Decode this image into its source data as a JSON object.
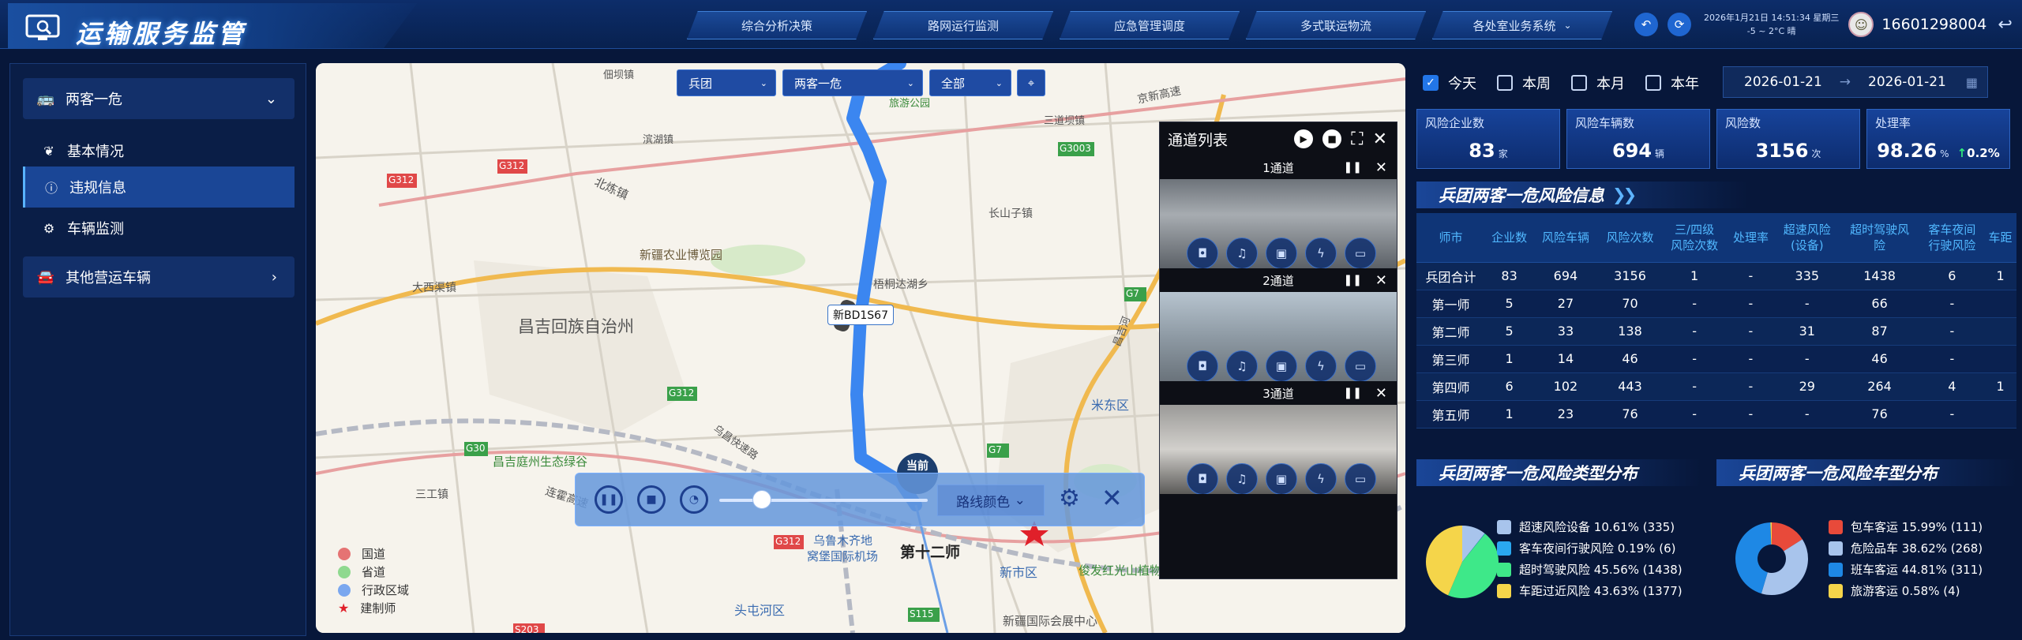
{
  "app": {
    "title": "运输服务监管"
  },
  "nav": [
    {
      "label": "综合分析决策"
    },
    {
      "label": "路网运行监测"
    },
    {
      "label": "应急管理调度"
    },
    {
      "label": "多式联运物流"
    },
    {
      "label": "各处室业务系统"
    }
  ],
  "header": {
    "datetime": "2026年1月21日 14:51:34 星期三",
    "weather": "-5 ~ 2°C 晴",
    "username": "16601298004"
  },
  "sidebar": {
    "group1": "两客一危",
    "items": [
      {
        "label": "基本情况"
      },
      {
        "label": "违规信息"
      },
      {
        "label": "车辆监测"
      }
    ],
    "group2": "其他营运车辆"
  },
  "map": {
    "filters": {
      "unit": "兵团",
      "type": "两客一危",
      "scope": "全部"
    },
    "vehicle_plate": "新BD1S67",
    "current_marker": "当前",
    "labels": {
      "region": "昌吉回族自治州",
      "division": "第十二师",
      "expo": "新疆农业博览园",
      "wetland": "昌吉庭州生态绿谷",
      "airport_line1": "乌鲁木齐地",
      "airport_line2": "窝堡国际机场",
      "place1": "北炼镇",
      "place2": "大西渠镇",
      "place3": "三工镇",
      "place4": "长山子镇",
      "place5": "梧桐达湖乡",
      "place6": "米东区",
      "place7": "新市区",
      "place8": "头屯河区",
      "place9": "新疆国际会展中心",
      "place10": "俊发红光山植物园",
      "place11": "佃坝镇",
      "place12": "滨湖镇",
      "place13": "三道坝镇",
      "place14": "旅游公园",
      "road1": "G312",
      "road2": "G312",
      "road3": "G312",
      "road4": "G312",
      "road5": "G30",
      "road6": "G3003",
      "road7": "G7",
      "road8": "G7",
      "road9": "S115",
      "road10": "S203",
      "road11": "京新高速",
      "road12": "连霍高速",
      "road13": "乌昌快速路",
      "road14": "昌吉河"
    },
    "playback": {
      "route_color_label": "路线颜色"
    },
    "legend": [
      {
        "label": "国道",
        "color": "#e57373"
      },
      {
        "label": "省道",
        "color": "#8fd98f"
      },
      {
        "label": "行政区域",
        "color": "#7aa7ef"
      },
      {
        "label": "建制师",
        "color": "#e0202a"
      }
    ]
  },
  "channels": {
    "title": "通道列表",
    "items": [
      {
        "label": "1通道"
      },
      {
        "label": "2通道"
      },
      {
        "label": "3通道"
      }
    ]
  },
  "period": {
    "options": [
      {
        "label": "今天",
        "checked": true
      },
      {
        "label": "本周",
        "checked": false
      },
      {
        "label": "本月",
        "checked": false
      },
      {
        "label": "本年",
        "checked": false
      }
    ],
    "start": "2026-01-21",
    "end": "2026-01-21"
  },
  "kpis": [
    {
      "label": "风险企业数",
      "value": "83",
      "unit": "家"
    },
    {
      "label": "风险车辆数",
      "value": "694",
      "unit": "辆"
    },
    {
      "label": "风险数",
      "value": "3156",
      "unit": "次"
    },
    {
      "label": "处理率",
      "value": "98.26",
      "unit": "%",
      "trend": "0.2%"
    }
  ],
  "risk_table": {
    "title": "兵团两客一危风险信息",
    "headers": [
      "师市",
      "企业数",
      "风险车辆",
      "风险次数",
      "三/四级\n风险次数",
      "处理率",
      "超速风险\n(设备)",
      "超时驾驶风\n险",
      "客车夜间\n行驶风险",
      "车距"
    ],
    "rows": [
      [
        "兵团合计",
        "83",
        "694",
        "3156",
        "1",
        "-",
        "335",
        "1438",
        "6",
        "1"
      ],
      [
        "第一师",
        "5",
        "27",
        "70",
        "-",
        "-",
        "-",
        "66",
        "-",
        ""
      ],
      [
        "第二师",
        "5",
        "33",
        "138",
        "-",
        "-",
        "31",
        "87",
        "-",
        ""
      ],
      [
        "第三师",
        "1",
        "14",
        "46",
        "-",
        "-",
        "-",
        "46",
        "-",
        ""
      ],
      [
        "第四师",
        "6",
        "102",
        "443",
        "-",
        "-",
        "29",
        "264",
        "4",
        "1"
      ],
      [
        "第五师",
        "1",
        "23",
        "76",
        "-",
        "-",
        "-",
        "76",
        "-",
        ""
      ]
    ]
  },
  "risk_type": {
    "title": "兵团两客一危风险类型分布",
    "items": [
      {
        "label": "超速风险设备",
        "pct": "10.61%",
        "count": "(335)",
        "value": 335,
        "color": "#a8c4ec"
      },
      {
        "label": "客车夜间行驶风险",
        "pct": "0.19%",
        "count": "(6)",
        "value": 6,
        "color": "#2aa8f0"
      },
      {
        "label": "超时驾驶风险",
        "pct": "45.56%",
        "count": "(1438)",
        "value": 1438,
        "color": "#3ee889"
      },
      {
        "label": "车距过近风险",
        "pct": "43.63%",
        "count": "(1377)",
        "value": 1377,
        "color": "#f5d54a"
      }
    ]
  },
  "vehicle_type": {
    "title": "兵团两客一危风险车型分布",
    "items": [
      {
        "label": "包车客运",
        "pct": "15.99%",
        "count": "(111)",
        "value": 111,
        "color": "#e84a3a"
      },
      {
        "label": "危险品车",
        "pct": "38.62%",
        "count": "(268)",
        "value": 268,
        "color": "#a8c4ec"
      },
      {
        "label": "班车客运",
        "pct": "44.81%",
        "count": "(311)",
        "value": 311,
        "color": "#1e88e5"
      },
      {
        "label": "旅游客运",
        "pct": "0.58%",
        "count": "(4)",
        "value": 4,
        "color": "#f5d54a"
      }
    ]
  }
}
